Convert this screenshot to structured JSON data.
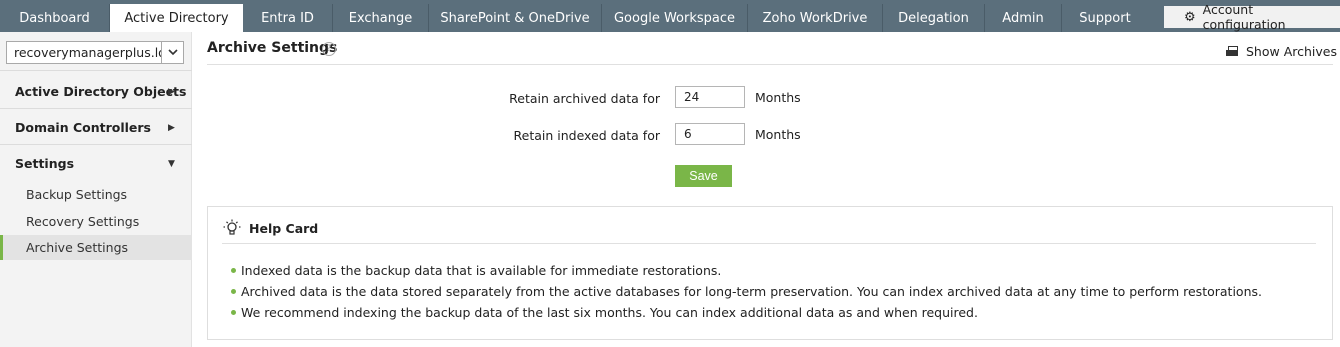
{
  "nav": {
    "tabs": [
      {
        "label": "Dashboard"
      },
      {
        "label": "Active Directory"
      },
      {
        "label": "Entra ID"
      },
      {
        "label": "Exchange"
      },
      {
        "label": "SharePoint & OneDrive"
      },
      {
        "label": "Google Workspace"
      },
      {
        "label": "Zoho WorkDrive"
      },
      {
        "label": "Delegation"
      },
      {
        "label": "Admin"
      },
      {
        "label": "Support"
      }
    ],
    "active_tab": "Active Directory",
    "account_config": "Account configuration"
  },
  "sidebar": {
    "domain": "recoverymanagerplus.loc",
    "sections": [
      {
        "label": "Active Directory Objects"
      },
      {
        "label": "Domain Controllers"
      },
      {
        "label": "Settings"
      }
    ],
    "settings_items": [
      {
        "label": "Backup Settings"
      },
      {
        "label": "Recovery Settings"
      },
      {
        "label": "Archive Settings"
      }
    ],
    "active_item": "Archive Settings"
  },
  "main": {
    "title": "Archive Settings",
    "help_glyph": "?",
    "show_archives": "Show Archives",
    "form": {
      "archived_label": "Retain archived data for",
      "archived_value": "24",
      "indexed_label": "Retain indexed data for",
      "indexed_value": "6",
      "unit": "Months",
      "save_label": "Save"
    },
    "help_card": {
      "title": "Help Card",
      "items": [
        "Indexed data is the backup data that is available for immediate restorations.",
        "Archived data is the data stored separately from the active databases for long-term preservation. You can index archived data at any time to perform restorations.",
        "We recommend indexing the backup data of the last six months. You can index additional data as and when required."
      ]
    }
  },
  "colors": {
    "nav_bg": "#5b6f7c",
    "accent_green": "#7ab648",
    "sidebar_bg": "#f3f3f3"
  }
}
